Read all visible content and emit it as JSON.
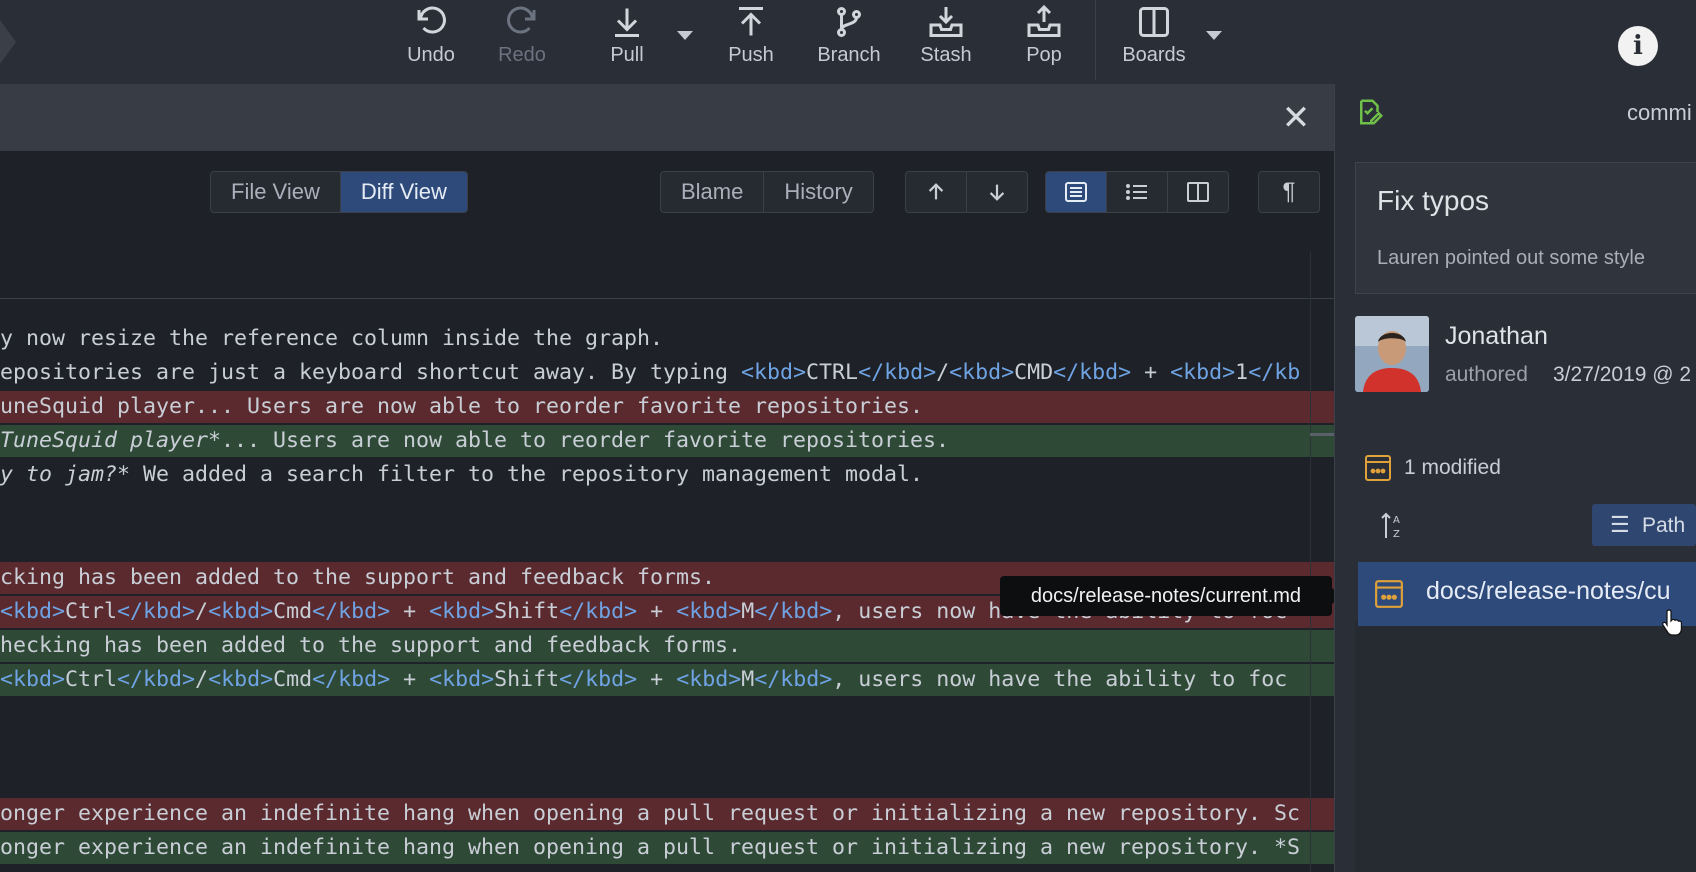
{
  "toolbar": {
    "undo": "Undo",
    "redo": "Redo",
    "pull": "Pull",
    "push": "Push",
    "branch": "Branch",
    "stash": "Stash",
    "pop": "Pop",
    "boards": "Boards",
    "info": "i"
  },
  "diff": {
    "view_tabs": [
      "File View",
      "Diff View"
    ],
    "active_view": "Diff View",
    "blame": "Blame",
    "history": "History",
    "tooltip": "docs/release-notes/current.md",
    "lines": [
      {
        "type": "ctx",
        "parts": [
          {
            "t": "y now resize the reference column inside the graph."
          }
        ]
      },
      {
        "type": "ctx",
        "parts": [
          {
            "t": "epositories are just a keyboard shortcut away. By typing "
          },
          {
            "t": "<kbd>",
            "c": "tag"
          },
          {
            "t": "CTRL"
          },
          {
            "t": "</kbd>",
            "c": "tag"
          },
          {
            "t": "/"
          },
          {
            "t": "<kbd>",
            "c": "tag"
          },
          {
            "t": "CMD"
          },
          {
            "t": "</kbd>",
            "c": "tag"
          },
          {
            "t": " + "
          },
          {
            "t": "<kbd>",
            "c": "tag"
          },
          {
            "t": "1"
          },
          {
            "t": "</kb",
            "c": "tag"
          }
        ]
      },
      {
        "type": "del",
        "parts": [
          {
            "t": "uneSquid player... Users are now able to reorder favorite repositories."
          }
        ]
      },
      {
        "type": "add",
        "parts": [
          {
            "t": "TuneSquid player*",
            "c": "it"
          },
          {
            "t": "... Users are now able to reorder favorite repositories."
          }
        ]
      },
      {
        "type": "ctx",
        "parts": [
          {
            "t": "y to jam?*",
            "c": "it"
          },
          {
            "t": " We added a search filter to the repository management modal."
          }
        ]
      },
      {
        "type": "del",
        "parts": [
          {
            "t": "cking has been added to the support and feedback forms."
          }
        ]
      },
      {
        "type": "del",
        "parts": [
          {
            "t": "<kbd>",
            "c": "tag"
          },
          {
            "t": "Ctrl"
          },
          {
            "t": "</kbd>",
            "c": "tag"
          },
          {
            "t": "/"
          },
          {
            "t": "<kbd>",
            "c": "tag"
          },
          {
            "t": "Cmd"
          },
          {
            "t": "</kbd>",
            "c": "tag"
          },
          {
            "t": " + "
          },
          {
            "t": "<kbd>",
            "c": "tag"
          },
          {
            "t": "Shift"
          },
          {
            "t": "</kbd>",
            "c": "tag"
          },
          {
            "t": " + "
          },
          {
            "t": "<kbd>",
            "c": "tag"
          },
          {
            "t": "M"
          },
          {
            "t": "</kbd>",
            "c": "tag"
          },
          {
            "t": ", users now have the ability to foc"
          }
        ]
      },
      {
        "type": "add",
        "parts": [
          {
            "t": "hecking has been added to the support and feedback forms."
          }
        ]
      },
      {
        "type": "add",
        "parts": [
          {
            "t": "<kbd>",
            "c": "tag"
          },
          {
            "t": "Ctrl"
          },
          {
            "t": "</kbd>",
            "c": "tag"
          },
          {
            "t": "/"
          },
          {
            "t": "<kbd>",
            "c": "tag"
          },
          {
            "t": "Cmd"
          },
          {
            "t": "</kbd>",
            "c": "tag"
          },
          {
            "t": " + "
          },
          {
            "t": "<kbd>",
            "c": "tag"
          },
          {
            "t": "Shift"
          },
          {
            "t": "</kbd>",
            "c": "tag"
          },
          {
            "t": " + "
          },
          {
            "t": "<kbd>",
            "c": "tag"
          },
          {
            "t": "M"
          },
          {
            "t": "</kbd>",
            "c": "tag"
          },
          {
            "t": ", users now have the ability to foc"
          }
        ]
      },
      {
        "type": "del",
        "parts": [
          {
            "t": "onger experience an indefinite hang when opening a pull request or initializing a new repository. Sc"
          }
        ]
      },
      {
        "type": "add",
        "parts": [
          {
            "t": "onger experience an indefinite hang when opening a pull request or initializing a new repository. *S"
          }
        ]
      }
    ]
  },
  "commit": {
    "header": "commi",
    "title": "Fix typos",
    "description": "Lauren pointed out some style",
    "author": "Jonathan",
    "authored_label": "authored",
    "authored_date": "3/27/2019 @ 2",
    "modified": "1 modified",
    "path_button": "Path",
    "file": "docs/release-notes/cu"
  }
}
